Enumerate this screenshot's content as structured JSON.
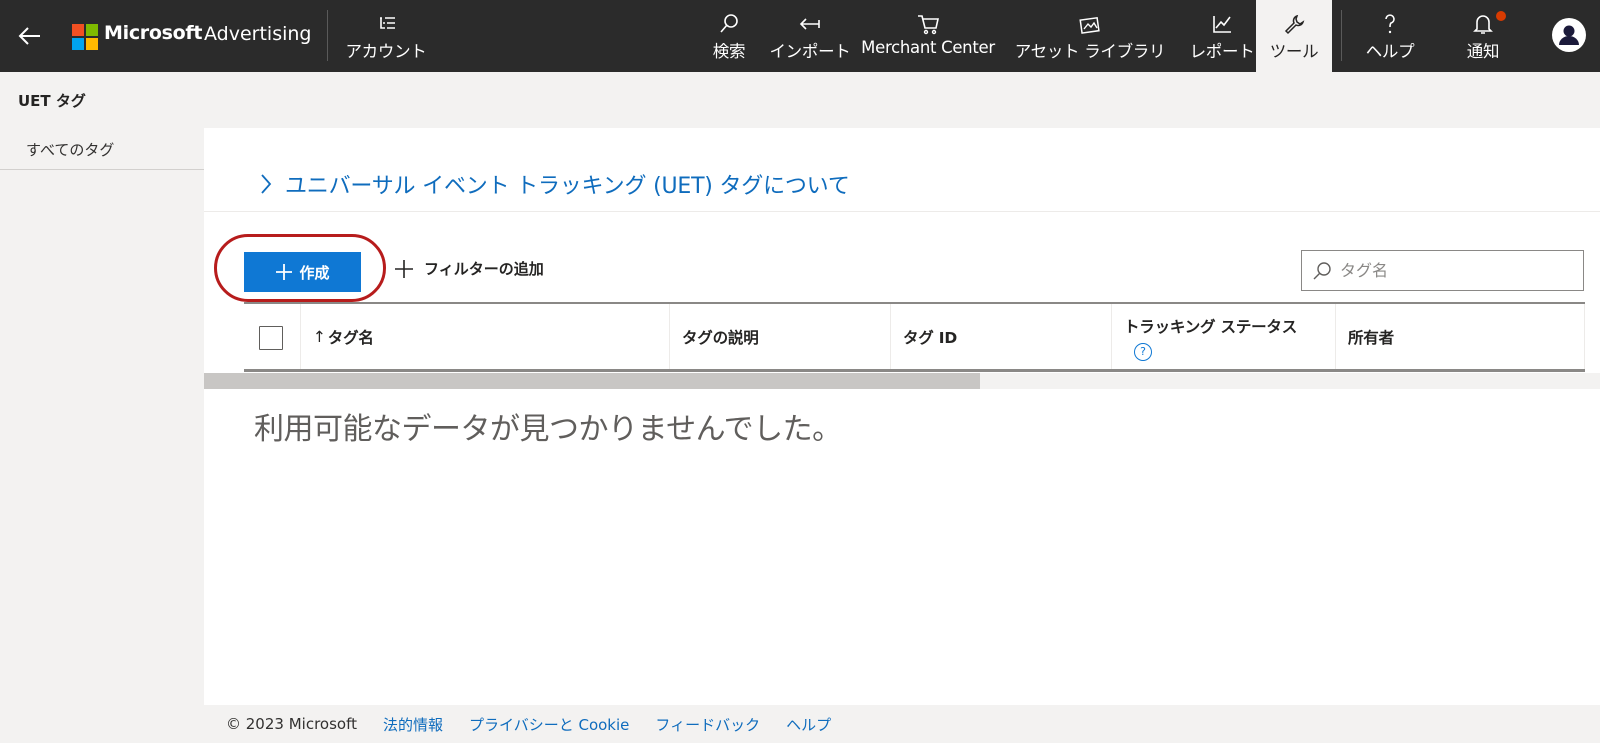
{
  "topbar": {
    "brand": "Microsoft",
    "product": "Advertising",
    "account_label": "アカウント",
    "nav": [
      {
        "label": "検索",
        "icon": "search-icon"
      },
      {
        "label": "インポート",
        "icon": "import-icon"
      },
      {
        "label": "Merchant Center",
        "icon": "cart-icon"
      },
      {
        "label": "アセット ライブラリ",
        "icon": "asset-library-icon"
      },
      {
        "label": "レポート",
        "icon": "chart-icon"
      },
      {
        "label": "ツール",
        "icon": "wrench-icon"
      },
      {
        "label": "ヘルプ",
        "icon": "question-icon"
      },
      {
        "label": "通知",
        "icon": "bell-icon"
      }
    ],
    "active_nav": "ツール",
    "logo_colors": [
      "#f25022",
      "#7fba00",
      "#00a4ef",
      "#ffb900"
    ]
  },
  "page": {
    "title": "UET タグ"
  },
  "sidebar": {
    "items": [
      {
        "label": "すべてのタグ"
      }
    ]
  },
  "main": {
    "about_link": "ユニバーサル イベント トラッキング (UET) タグについて",
    "create_button": "作成",
    "add_filter": "フィルターの追加",
    "search_placeholder": "タグ名",
    "columns": [
      {
        "label": "タグ名",
        "sort": "ascending"
      },
      {
        "label": "タグの説明"
      },
      {
        "label": "タグ ID"
      },
      {
        "label": "トラッキング ステータス"
      },
      {
        "label": "所有者"
      }
    ],
    "empty_message": "利用可能なデータが見つかりませんでした。"
  },
  "footer": {
    "copyright": "© 2023 Microsoft",
    "links": [
      "法的情報",
      "プライバシーと Cookie",
      "フィードバック",
      "ヘルプ"
    ]
  },
  "colors": {
    "topbar_bg": "#2b2b2b",
    "accent": "#0f78d4",
    "link": "#0f6cbd",
    "highlight_ring": "#b71c1c",
    "notification_dot": "#d83b01"
  }
}
